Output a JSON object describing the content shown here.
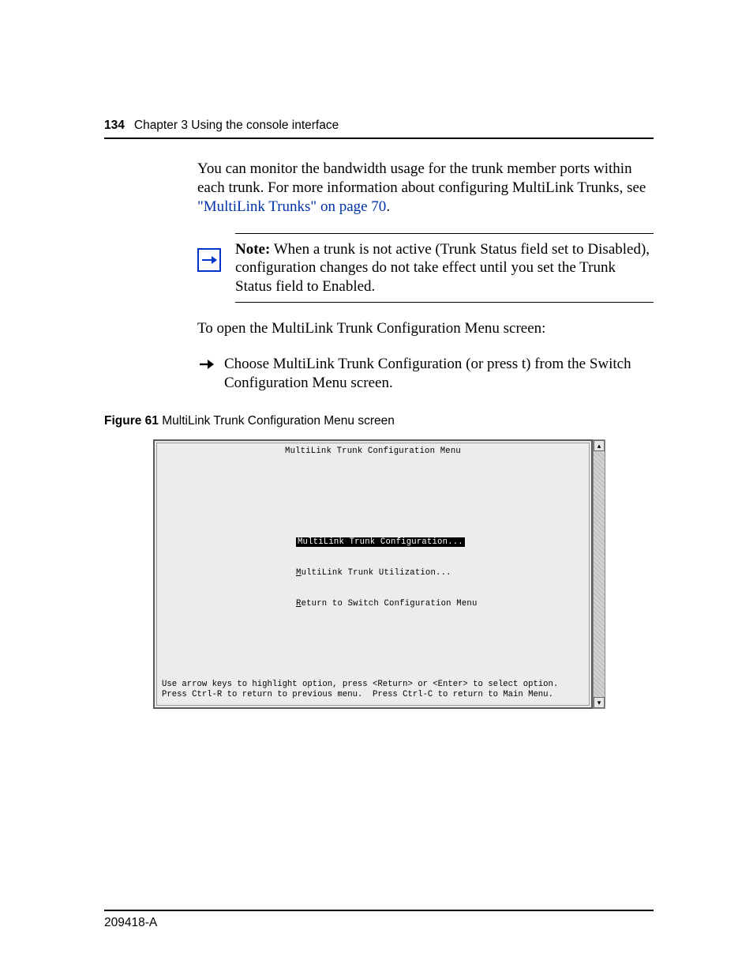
{
  "header": {
    "page_number": "134",
    "chapter": "Chapter 3  Using the console interface"
  },
  "para1_part1": "You can monitor the bandwidth usage for the trunk member ports within each trunk. For more information about configuring MultiLink Trunks, see ",
  "para1_link": "\"MultiLink Trunks\" on page 70",
  "para1_part2": ".",
  "note": {
    "label": "Note:",
    "text": " When a trunk is not active (Trunk Status field set to Disabled), configuration changes do not take effect until you set the Trunk Status field to Enabled."
  },
  "para2": "To open the MultiLink Trunk Configuration Menu screen:",
  "step1": "Choose MultiLink Trunk Configuration (or press t) from the Switch Configuration Menu screen.",
  "figure": {
    "label": "Figure 61",
    "caption": "   MultiLink Trunk Configuration Menu screen"
  },
  "terminal": {
    "title": "MultiLink Trunk Configuration Menu",
    "menu_sel": "MultiLink Trunk Configuration...",
    "menu_2_first": "M",
    "menu_2_rest": "ultiLink Trunk Utilization...",
    "menu_3_first": "R",
    "menu_3_rest": "eturn to Switch Configuration Menu",
    "foot1": "Use arrow keys to highlight option, press <Return> or <Enter> to select option.",
    "foot2": "Press Ctrl-R to return to previous menu.  Press Ctrl-C to return to Main Menu."
  },
  "scroll": {
    "up": "▴",
    "down": "▾"
  },
  "footer": "209418-A"
}
